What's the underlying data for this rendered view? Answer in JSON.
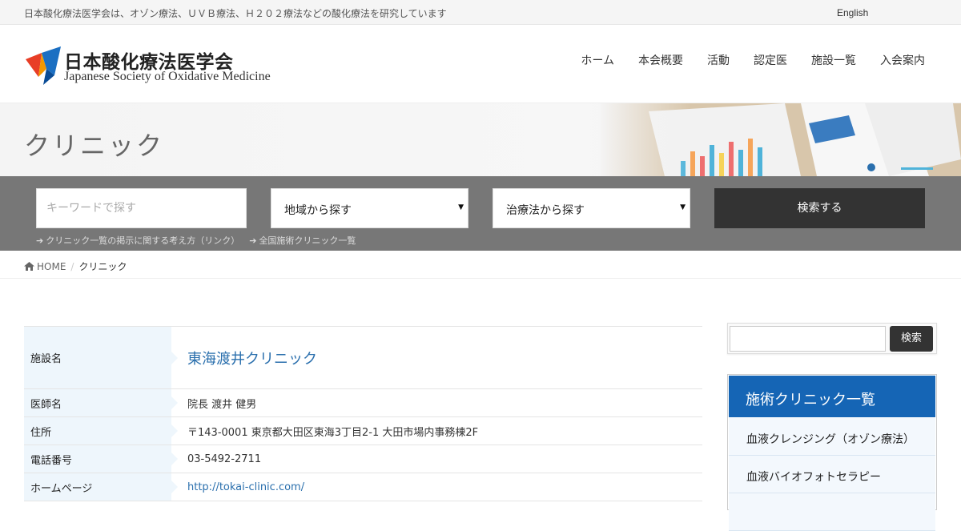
{
  "topbar": {
    "tagline": "日本酸化療法医学会は、オゾン療法、ＵＶＢ療法、Ｈ２０２療法などの酸化療法を研究しています",
    "lang": "English"
  },
  "logo": {
    "jp": "日本酸化療法医学会",
    "en": "Japanese Society of Oxidative Medicine"
  },
  "nav": [
    "ホーム",
    "本会概要",
    "活動",
    "認定医",
    "施設一覧",
    "入会案内"
  ],
  "page_title": "クリニック",
  "search": {
    "keyword_placeholder": "キーワードで探す",
    "region_label": "地域から探す",
    "therapy_label": "治療法から探す",
    "button": "検索する",
    "links": [
      "クリニック一覧の掲示に関する考え方（リンク）",
      "全国施術クリニック一覧"
    ]
  },
  "breadcrumb": {
    "home": "HOME",
    "current": "クリニック"
  },
  "info": [
    {
      "label": "施設名",
      "value": "東海渡井クリニック"
    },
    {
      "label": "医師名",
      "value": "院長 渡井 健男"
    },
    {
      "label": "住所",
      "value": "〒143-0001 東京都大田区東海3丁目2-1 大田市場内事務棟2F"
    },
    {
      "label": "電話番号",
      "value": "03-5492-2711"
    },
    {
      "label": "ホームページ",
      "value": "http://tokai-clinic.com/"
    }
  ],
  "sidebar": {
    "search_button": "検索",
    "clinic_list": {
      "title": "施術クリニック一覧",
      "items": [
        "血液クレンジング（オゾン療法）",
        "血液バイオフォトセラピー"
      ]
    }
  },
  "colors": {
    "accent": "#1565b5",
    "link": "#2a6fad",
    "search_band": "#777777"
  }
}
